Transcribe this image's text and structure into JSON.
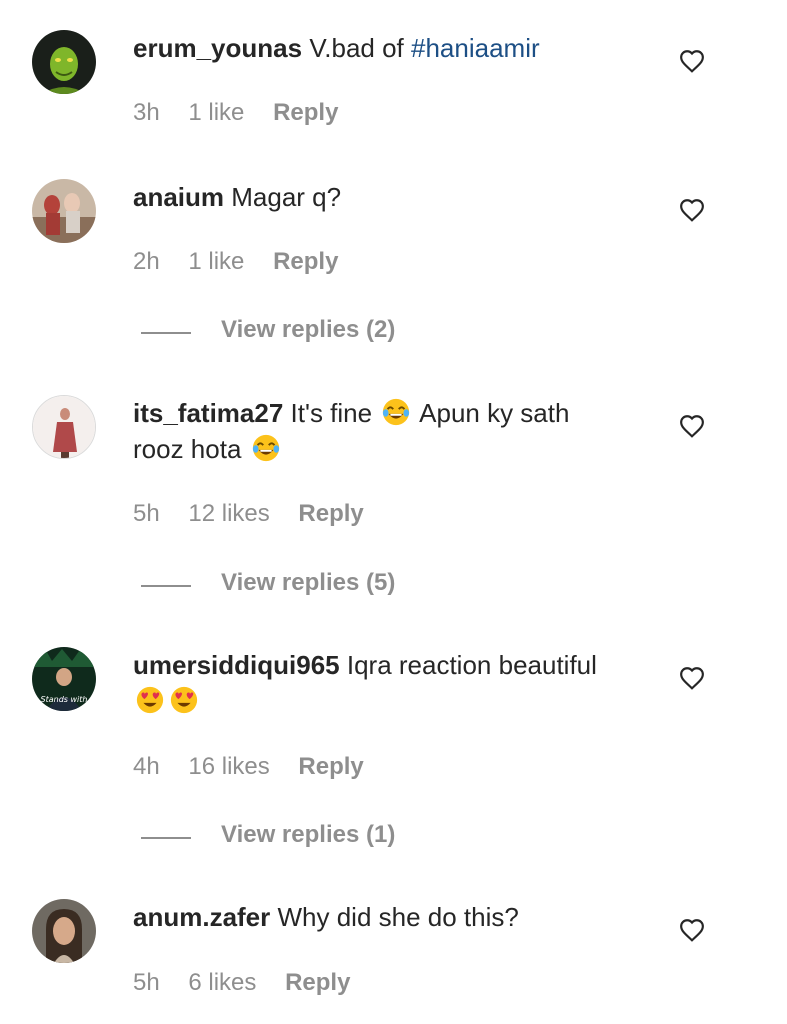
{
  "comments": [
    {
      "username": "erum_younas",
      "text_before": "V.bad of ",
      "hashtag": "#haniaamir",
      "time": "3h",
      "likes": "1 like",
      "reply": "Reply"
    },
    {
      "username": "anaium",
      "text": "Magar q?",
      "time": "2h",
      "likes": "1 like",
      "reply": "Reply",
      "view_replies": "View replies (2)"
    },
    {
      "username": "its_fatima27",
      "text_part1": "It's fine",
      "text_part2": "Apun ky sath",
      "text_line2": "rooz hota",
      "time": "5h",
      "likes": "12 likes",
      "reply": "Reply",
      "view_replies": "View replies (5)"
    },
    {
      "username": "umersiddiqui965",
      "text": "Iqra reaction beautiful",
      "avatar_caption": "Stands with",
      "time": "4h",
      "likes": "16 likes",
      "reply": "Reply",
      "view_replies": "View replies (1)"
    },
    {
      "username": "anum.zafer",
      "text": "Why did she do this?",
      "time": "5h",
      "likes": "6 likes",
      "reply": "Reply"
    }
  ],
  "icons": {
    "heart": "heart-outline-icon",
    "emoji_laugh": "face-with-tears-of-joy-icon",
    "emoji_heart_eyes": "smiling-face-with-heart-eyes-icon"
  },
  "colors": {
    "username": "#262626",
    "meta": "#8e8e8e",
    "hashtag": "#1d4f85"
  }
}
